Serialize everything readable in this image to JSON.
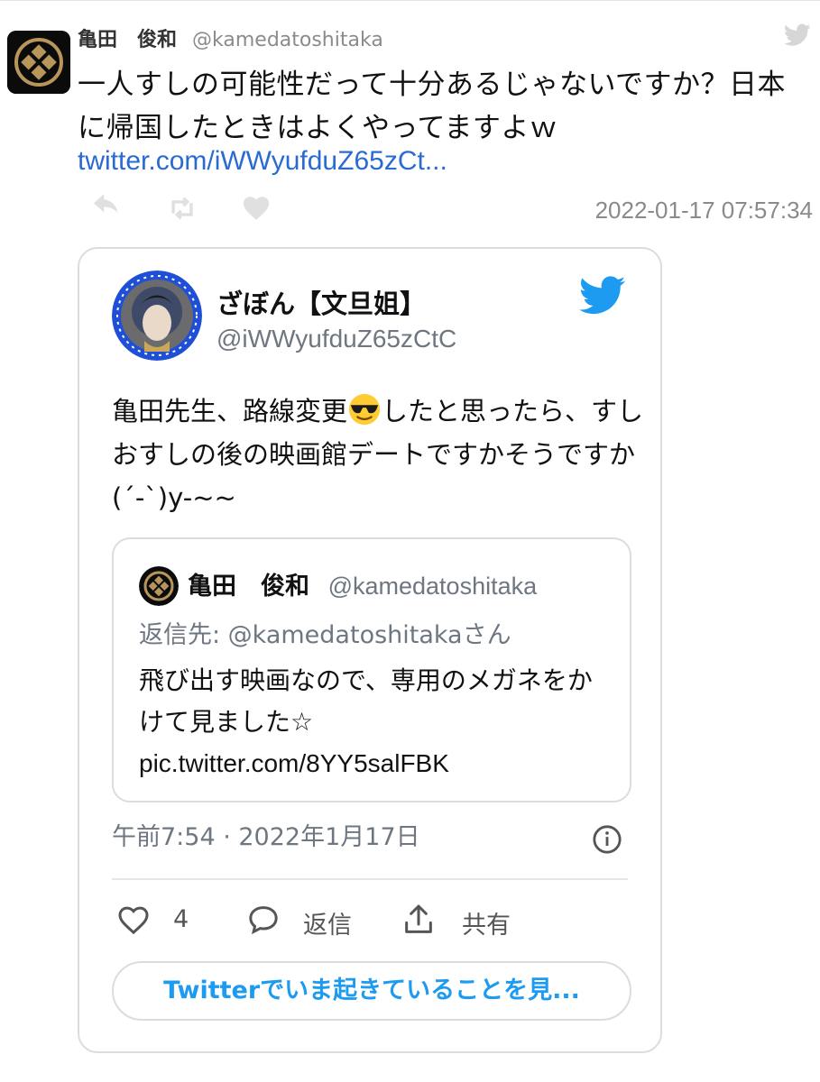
{
  "outer_tweet": {
    "author_name": "亀田　俊和",
    "author_handle": "@kamedatoshitaka",
    "text": "一人すしの可能性だって十分あるじゃないですか？日本に帰国したときはよくやってますよｗ",
    "link": "twitter.com/iWWyufduZ65zCt...",
    "timestamp": "2022-01-17 07:57:34",
    "icons": [
      "reply-icon",
      "retweet-icon",
      "like-icon",
      "twitter-bird-icon"
    ]
  },
  "embed": {
    "author_name": "ざぼん【文旦姐】",
    "author_handle": "@iWWyufduZ65zCtC",
    "text_before_emoji": "亀田先生、路線変更",
    "text_after_emoji": "したと思ったら、すしおすしの後の映画館デートですかそうですか(´-`)y-~~",
    "quote": {
      "author_name": "亀田　俊和",
      "author_handle": "@kamedatoshitaka",
      "reply_to": "返信先: @kamedatoshitakaさん",
      "text": "飛び出す映画なので、専用のメガネをかけて見ました☆",
      "pic_link": "pic.twitter.com/8YY5salFBK"
    },
    "meta_time": "午前7:54 · 2022年1月17日",
    "likes_count": "4",
    "reply_label": "返信",
    "share_label": "共有",
    "see_more_label": "Twitterでいま起きていることを見..."
  },
  "colors": {
    "twitter_blue": "#1d9bf0",
    "link_blue": "#2a6bd1",
    "muted_gray": "#6e7781",
    "border": "#d9dde1"
  }
}
